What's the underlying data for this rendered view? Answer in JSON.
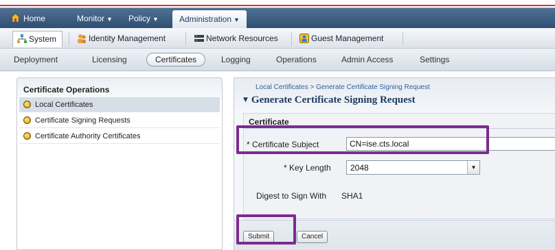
{
  "topnav": {
    "home": "Home",
    "monitor": "Monitor",
    "policy": "Policy",
    "administration": "Administration",
    "caret": "▼"
  },
  "admin_tabs": [
    "System",
    "Identity Management",
    "Network Resources",
    "Guest Management"
  ],
  "system_tabs": [
    "Deployment",
    "Licensing",
    "Certificates",
    "Logging",
    "Operations",
    "Admin Access",
    "Settings"
  ],
  "left_panel": {
    "title": "Certificate Operations",
    "items": [
      "Local Certificates",
      "Certificate Signing Requests",
      "Certificate Authority Certificates"
    ]
  },
  "main": {
    "breadcrumb": "Local Certificates > Generate Certificate Signing Request",
    "title": "Generate Certificate Signing Request",
    "section": "Certificate",
    "fields": {
      "subject_label": "* Certificate Subject",
      "subject_value": "CN=ise.cts.local",
      "key_length_label": "* Key Length",
      "key_length_value": "2048",
      "digest_label": "Digest to Sign With",
      "digest_value": "SHA1"
    },
    "buttons": {
      "submit": "Submit",
      "cancel": "Cancel"
    }
  },
  "colors": {
    "nav_bar": "#2f4f73",
    "highlight_box": "#7c2b8f",
    "top_rule": "#e0302e",
    "link": "#2c5f9e",
    "title": "#1c3a5d"
  },
  "icons": {
    "home": "home-icon",
    "system": "system-icon",
    "identity": "identity-icon",
    "network": "network-icon",
    "guest": "guest-icon",
    "certificate": "certificate-icon",
    "dropdown": "chevron-down-icon"
  }
}
